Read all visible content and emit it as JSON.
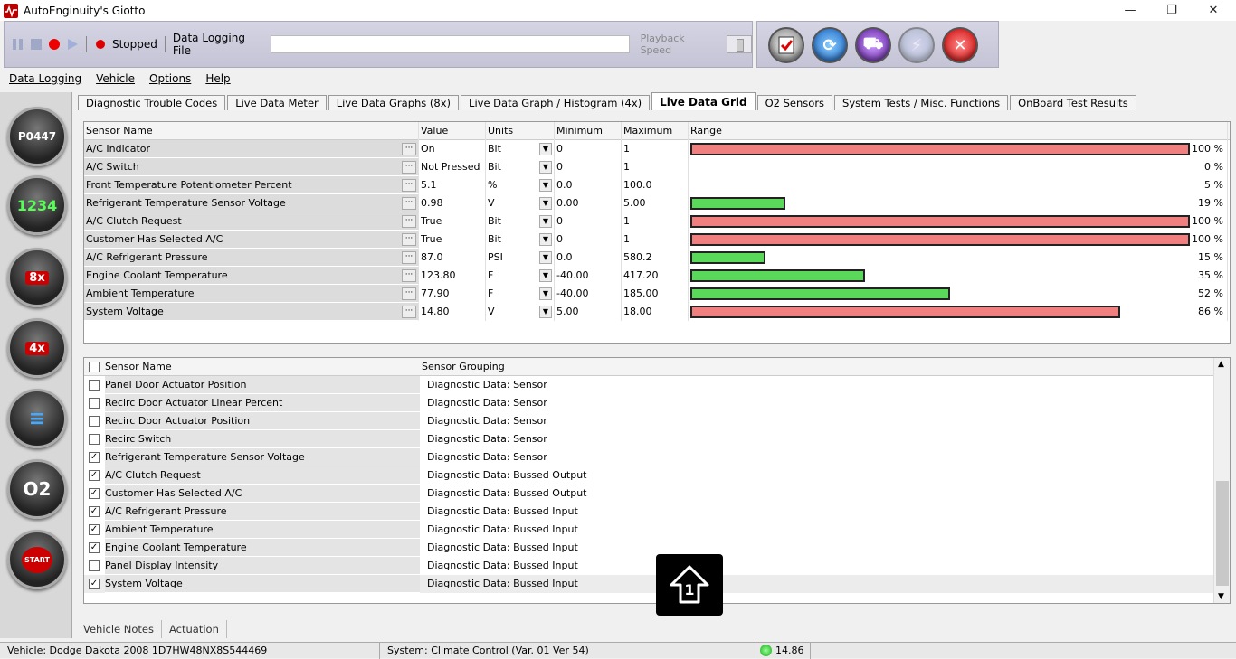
{
  "window": {
    "title": "AutoEnginuity's Giotto",
    "minimize": "—",
    "maximize": "❐",
    "close": "✕"
  },
  "toolbar": {
    "status": "Stopped",
    "data_logging_label": "Data Logging File",
    "data_logging_value": "",
    "playback_label": "Playback Speed"
  },
  "menu": [
    "Data Logging",
    "Vehicle",
    "Options",
    "Help"
  ],
  "sidebar": [
    {
      "name": "dtc-button",
      "glyph": "P0447"
    },
    {
      "name": "live-data-meter-button",
      "glyph": "1234"
    },
    {
      "name": "live-data-graphs-8x-button",
      "glyph": "8x"
    },
    {
      "name": "live-data-graph-4x-button",
      "glyph": "4x"
    },
    {
      "name": "live-data-grid-button",
      "glyph": "≡"
    },
    {
      "name": "o2-sensors-button",
      "glyph": "O2"
    },
    {
      "name": "system-tests-button",
      "glyph": "START"
    }
  ],
  "tabs": [
    "Diagnostic Trouble Codes",
    "Live Data Meter",
    "Live Data Graphs (8x)",
    "Live Data Graph / Histogram (4x)",
    "Live Data Grid",
    "O2 Sensors",
    "System Tests / Misc. Functions",
    "OnBoard Test Results"
  ],
  "active_tab": 4,
  "grid": {
    "headers": [
      "Sensor Name",
      "Value",
      "Units",
      "Minimum",
      "Maximum",
      "Range"
    ],
    "rows": [
      {
        "name": "A/C Indicator",
        "value": "On",
        "unit": "Bit",
        "min": "0",
        "max": "1",
        "pct": 100,
        "pct_label": "100 %",
        "color": "#f08080"
      },
      {
        "name": "A/C Switch",
        "value": "Not Pressed",
        "unit": "Bit",
        "min": "0",
        "max": "1",
        "pct": 0,
        "pct_label": "0 %",
        "color": "#f08080"
      },
      {
        "name": "Front Temperature Potentiometer Percent",
        "value": "5.1",
        "unit": "%",
        "min": "0.0",
        "max": "100.0",
        "pct": 5,
        "pct_label": "5 %",
        "color": "none"
      },
      {
        "name": "Refrigerant Temperature Sensor Voltage",
        "value": "0.98",
        "unit": "V",
        "min": "0.00",
        "max": "5.00",
        "pct": 19,
        "pct_label": "19 %",
        "color": "#5ad85a"
      },
      {
        "name": "A/C Clutch Request",
        "value": "True",
        "unit": "Bit",
        "min": "0",
        "max": "1",
        "pct": 100,
        "pct_label": "100 %",
        "color": "#f08080"
      },
      {
        "name": "Customer Has Selected A/C",
        "value": "True",
        "unit": "Bit",
        "min": "0",
        "max": "1",
        "pct": 100,
        "pct_label": "100 %",
        "color": "#f08080"
      },
      {
        "name": "A/C Refrigerant Pressure",
        "value": "87.0",
        "unit": "PSI",
        "min": "0.0",
        "max": "580.2",
        "pct": 15,
        "pct_label": "15 %",
        "color": "#5ad85a"
      },
      {
        "name": "Engine Coolant Temperature",
        "value": "123.80",
        "unit": "F",
        "min": "-40.00",
        "max": "417.20",
        "pct": 35,
        "pct_label": "35 %",
        "color": "#5ad85a"
      },
      {
        "name": "Ambient Temperature",
        "value": "77.90",
        "unit": "F",
        "min": "-40.00",
        "max": "185.00",
        "pct": 52,
        "pct_label": "52 %",
        "color": "#5ad85a"
      },
      {
        "name": "System Voltage",
        "value": "14.80",
        "unit": "V",
        "min": "5.00",
        "max": "18.00",
        "pct": 86,
        "pct_label": "86 %",
        "color": "#f08080"
      }
    ]
  },
  "sensor_list": {
    "headers": [
      "Sensor Name",
      "Sensor Grouping"
    ],
    "rows": [
      {
        "name": "Panel Door Actuator Position",
        "group": "Diagnostic Data: Sensor",
        "checked": false
      },
      {
        "name": "Recirc Door Actuator Linear Percent",
        "group": "Diagnostic Data: Sensor",
        "checked": false
      },
      {
        "name": "Recirc Door Actuator Position",
        "group": "Diagnostic Data: Sensor",
        "checked": false
      },
      {
        "name": "Recirc Switch",
        "group": "Diagnostic Data: Sensor",
        "checked": false
      },
      {
        "name": "Refrigerant Temperature Sensor Voltage",
        "group": "Diagnostic Data: Sensor",
        "checked": true
      },
      {
        "name": "A/C Clutch Request",
        "group": "Diagnostic Data: Bussed Output",
        "checked": true
      },
      {
        "name": "Customer Has Selected A/C",
        "group": "Diagnostic Data: Bussed Output",
        "checked": true
      },
      {
        "name": "A/C Refrigerant Pressure",
        "group": "Diagnostic Data: Bussed Input",
        "checked": true
      },
      {
        "name": "Ambient Temperature",
        "group": "Diagnostic Data: Bussed Input",
        "checked": true
      },
      {
        "name": "Engine Coolant Temperature",
        "group": "Diagnostic Data: Bussed Input",
        "checked": true
      },
      {
        "name": "Panel Display Intensity",
        "group": "Diagnostic Data: Bussed Input",
        "checked": false
      },
      {
        "name": "System Voltage",
        "group": "Diagnostic Data: Bussed Input",
        "checked": true
      }
    ]
  },
  "bottom_tabs": [
    "Vehicle Notes",
    "Actuation"
  ],
  "status": {
    "vehicle": "Vehicle: Dodge  Dakota  2008  1D7HW48NX8S544469",
    "system": "System: Climate Control (Var. 01 Ver 54)",
    "voltage": "14.86"
  },
  "overlay": {
    "glyph": "1"
  }
}
